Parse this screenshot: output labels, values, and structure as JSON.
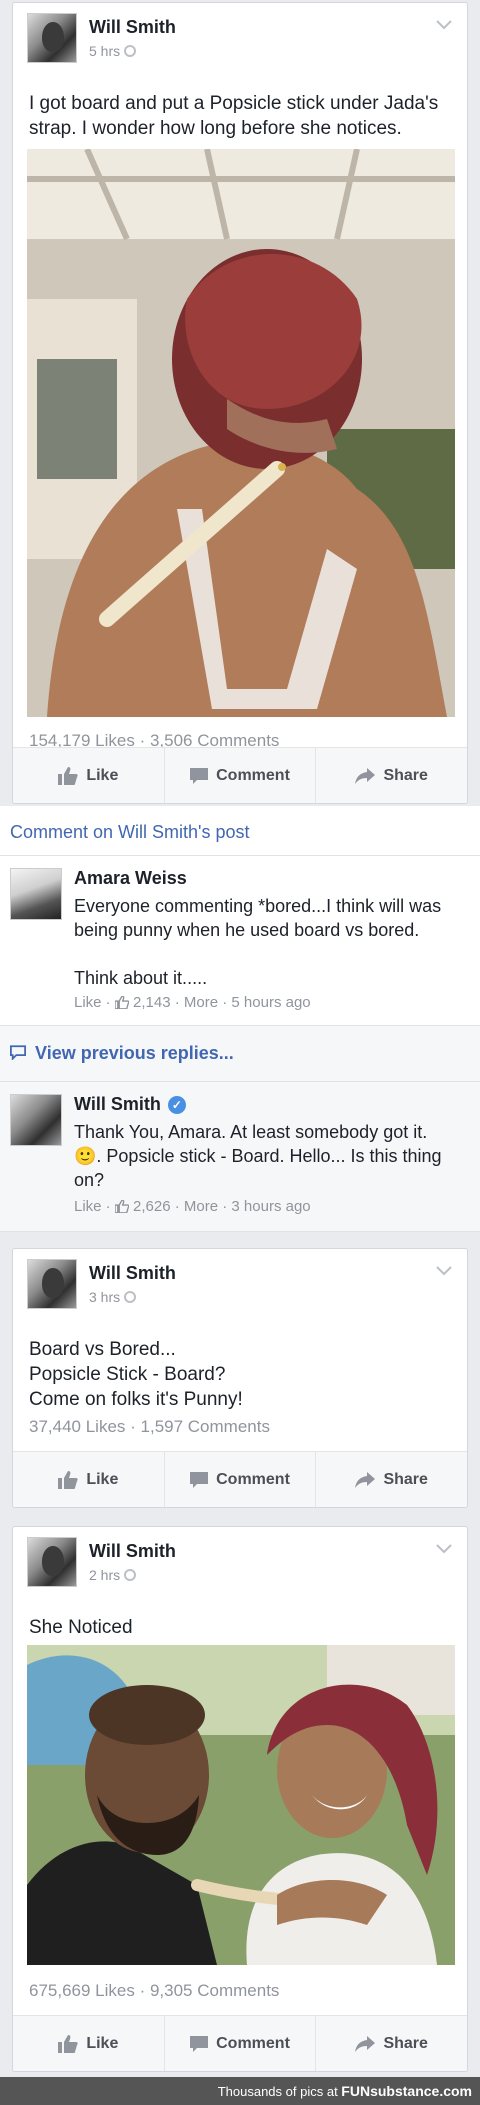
{
  "posts": [
    {
      "author": "Will Smith",
      "time": "5 hrs",
      "text": "I got board and put a Popsicle stick under Jada's strap. I wonder how long before she notices.",
      "stats": "154,179 Likes · 3,506 Comments"
    },
    {
      "author": "Will Smith",
      "time": "3 hrs",
      "text_lines": [
        "Board vs Bored...",
        "Popsicle Stick - Board?",
        "Come on folks it's Punny!"
      ],
      "stats": "37,440 Likes · 1,597 Comments"
    },
    {
      "author": "Will Smith",
      "time": "2 hrs",
      "text": "She Noticed",
      "stats": "675,669 Likes · 9,305 Comments"
    }
  ],
  "actions": {
    "like": "Like",
    "comment": "Comment",
    "share": "Share"
  },
  "comment_header": "Comment on Will Smith's post",
  "comments": [
    {
      "name": "Amara Weiss",
      "line1": "Everyone commenting *bored...I think will was being punny when he used board vs bored.",
      "line2": "Think about it.....",
      "like_label": "Like ·",
      "likes": "2,143",
      "more": "· More ·",
      "time": "5 hours ago"
    },
    {
      "name": "Will Smith",
      "text": "Thank You, Amara. At least somebody got it. 🙂. Popsicle stick - Board. Hello... Is this thing on?",
      "like_label": "Like ·",
      "likes": "2,626",
      "more": "· More ·",
      "time": "3 hours ago"
    }
  ],
  "view_previous": "View previous replies...",
  "footer": {
    "text": "Thousands of pics at ",
    "brand": "FUNsubstance.com"
  },
  "colors": {
    "link": "#4267b2",
    "meta": "#90949c",
    "verified": "#4a90e2"
  }
}
